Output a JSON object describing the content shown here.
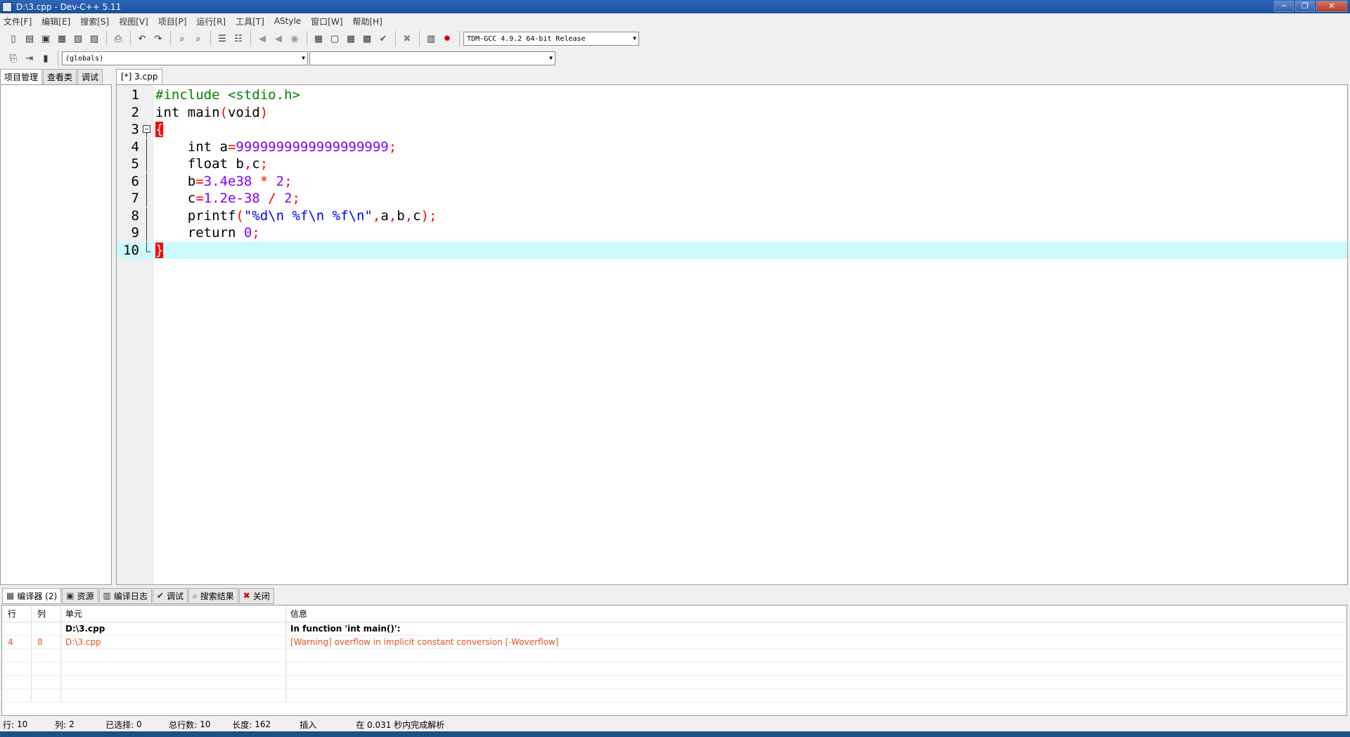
{
  "window": {
    "title": "D:\\3.cpp - Dev-C++ 5.11"
  },
  "menu": [
    "文件[F]",
    "编辑[E]",
    "搜索[S]",
    "视图[V]",
    "项目[P]",
    "运行[R]",
    "工具[T]",
    "AStyle",
    "窗口[W]",
    "帮助[H]"
  ],
  "toolbar": {
    "compiler_select": "TDM-GCC 4.9.2 64-bit Release"
  },
  "toolbar2": {
    "scope_select": "(globals)",
    "member_select": ""
  },
  "left_tabs": [
    "项目管理",
    "查看类",
    "调试"
  ],
  "editor": {
    "file_tab": "[*] 3.cpp",
    "lines": [
      {
        "num": "1",
        "segments": [
          {
            "cls": "pp",
            "text": "#include <stdio.h>"
          }
        ]
      },
      {
        "num": "2",
        "segments": [
          {
            "cls": "kw",
            "text": "int main"
          },
          {
            "cls": "sym",
            "text": "("
          },
          {
            "cls": "kw",
            "text": "void"
          },
          {
            "cls": "sym",
            "text": ")"
          }
        ]
      },
      {
        "num": "3",
        "segments": [
          {
            "cls": "brace",
            "text": "{"
          }
        ]
      },
      {
        "num": "4",
        "segments": [
          {
            "cls": "kw",
            "text": "    int a"
          },
          {
            "cls": "sym",
            "text": "="
          },
          {
            "cls": "num",
            "text": "9999999999999999999"
          },
          {
            "cls": "sym",
            "text": ";"
          }
        ]
      },
      {
        "num": "5",
        "segments": [
          {
            "cls": "kw",
            "text": "    float b"
          },
          {
            "cls": "sym",
            "text": ","
          },
          {
            "cls": "kw",
            "text": "c"
          },
          {
            "cls": "sym",
            "text": ";"
          }
        ]
      },
      {
        "num": "6",
        "segments": [
          {
            "cls": "kw",
            "text": "    b"
          },
          {
            "cls": "sym",
            "text": "="
          },
          {
            "cls": "num",
            "text": "3.4e38"
          },
          {
            "cls": "sym",
            "text": " * "
          },
          {
            "cls": "num",
            "text": "2"
          },
          {
            "cls": "sym",
            "text": ";"
          }
        ]
      },
      {
        "num": "7",
        "segments": [
          {
            "cls": "kw",
            "text": "    c"
          },
          {
            "cls": "sym",
            "text": "="
          },
          {
            "cls": "num",
            "text": "1.2e-38"
          },
          {
            "cls": "sym",
            "text": " / "
          },
          {
            "cls": "num",
            "text": "2"
          },
          {
            "cls": "sym",
            "text": ";"
          }
        ]
      },
      {
        "num": "8",
        "segments": [
          {
            "cls": "kw",
            "text": "    printf"
          },
          {
            "cls": "sym",
            "text": "("
          },
          {
            "cls": "str",
            "text": "\"%d\\n %f\\n %f\\n\""
          },
          {
            "cls": "sym",
            "text": ","
          },
          {
            "cls": "kw",
            "text": "a"
          },
          {
            "cls": "sym",
            "text": ","
          },
          {
            "cls": "kw",
            "text": "b"
          },
          {
            "cls": "sym",
            "text": ","
          },
          {
            "cls": "kw",
            "text": "c"
          },
          {
            "cls": "sym",
            "text": ");"
          }
        ]
      },
      {
        "num": "9",
        "segments": [
          {
            "cls": "kw",
            "text": "    return "
          },
          {
            "cls": "num",
            "text": "0"
          },
          {
            "cls": "sym",
            "text": ";"
          }
        ]
      },
      {
        "num": "10",
        "segments": [
          {
            "cls": "brace",
            "text": "}"
          }
        ]
      }
    ]
  },
  "bottom_tabs": [
    {
      "label": "编译器 (2)",
      "icon": "grid-icon"
    },
    {
      "label": "资源",
      "icon": "resource-icon"
    },
    {
      "label": "编译日志",
      "icon": "chart-icon"
    },
    {
      "label": "调试",
      "icon": "check-icon"
    },
    {
      "label": "搜索结果",
      "icon": "search-icon"
    },
    {
      "label": "关闭",
      "icon": "close-icon"
    }
  ],
  "results": {
    "headers": [
      "行",
      "列",
      "单元",
      "信息"
    ],
    "rows": [
      {
        "line": "",
        "col": "",
        "unit": "D:\\3.cpp",
        "message": "In function 'int main()':",
        "kind": "bold"
      },
      {
        "line": "4",
        "col": "8",
        "unit": "D:\\3.cpp",
        "message": "[Warning] overflow in implicit constant conversion [-Woverflow]",
        "kind": "warn"
      }
    ]
  },
  "status": {
    "line_label": "行:",
    "line": "10",
    "col_label": "列:",
    "col": "2",
    "sel_label": "已选择:",
    "sel": "0",
    "total_label": "总行数:",
    "total": "10",
    "len_label": "长度:",
    "len": "162",
    "mode": "插入",
    "parse": "在 0.031 秒内完成解析"
  },
  "colors": {
    "current_line": "#cdfafa",
    "brace_match": "#ff0000",
    "preprocessor": "#008000",
    "number": "#8000ff",
    "string": "#0000ff",
    "warning": "#e8541d"
  }
}
